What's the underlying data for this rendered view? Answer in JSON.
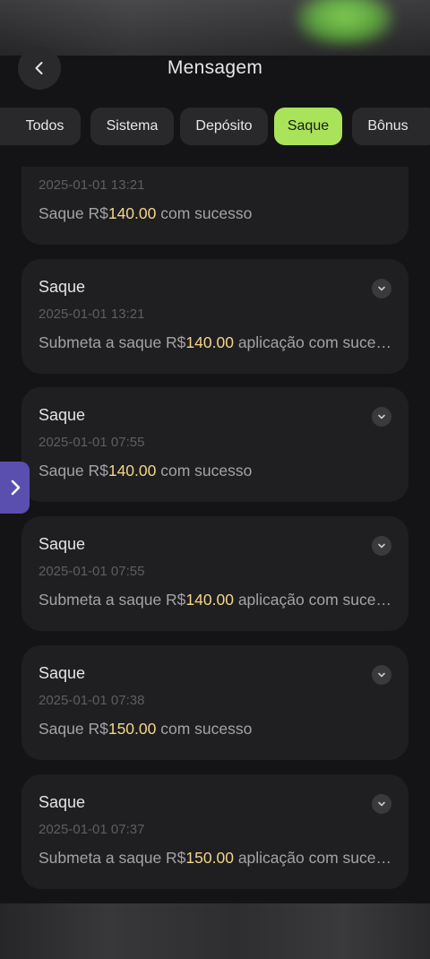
{
  "header": {
    "title": "Mensagem"
  },
  "tabs": [
    {
      "label": "Todos",
      "active": false
    },
    {
      "label": "Sistema",
      "active": false
    },
    {
      "label": "Depósito",
      "active": false
    },
    {
      "label": "Saque",
      "active": true
    },
    {
      "label": "Bônus",
      "active": false
    }
  ],
  "messages": [
    {
      "title": "",
      "date": "2025-01-01 13:21",
      "body_prefix": "Saque R$",
      "amount": "140.00",
      "body_suffix": " com sucesso"
    },
    {
      "title": "Saque",
      "date": "2025-01-01 13:21",
      "body_prefix": "Submeta a saque R$",
      "amount": "140.00",
      "body_suffix": " aplicação com sucesso"
    },
    {
      "title": "Saque",
      "date": "2025-01-01 07:55",
      "body_prefix": "Saque R$",
      "amount": "140.00",
      "body_suffix": " com sucesso"
    },
    {
      "title": "Saque",
      "date": "2025-01-01 07:55",
      "body_prefix": "Submeta a saque R$",
      "amount": "140.00",
      "body_suffix": " aplicação com sucesso"
    },
    {
      "title": "Saque",
      "date": "2025-01-01 07:38",
      "body_prefix": "Saque R$",
      "amount": "150.00",
      "body_suffix": " com sucesso"
    },
    {
      "title": "Saque",
      "date": "2025-01-01 07:37",
      "body_prefix": "Submeta a saque R$",
      "amount": "150.00",
      "body_suffix": " aplicação com sucesso"
    }
  ],
  "colors": {
    "accent": "#a9e35a",
    "amount": "#f2d58a",
    "side_tab": "#5a4fae",
    "card": "#1f1f21",
    "background": "#141416"
  },
  "icons": {
    "back": "chevron-left-icon",
    "expand": "chevron-down-icon",
    "side": "chevron-right-icon"
  }
}
